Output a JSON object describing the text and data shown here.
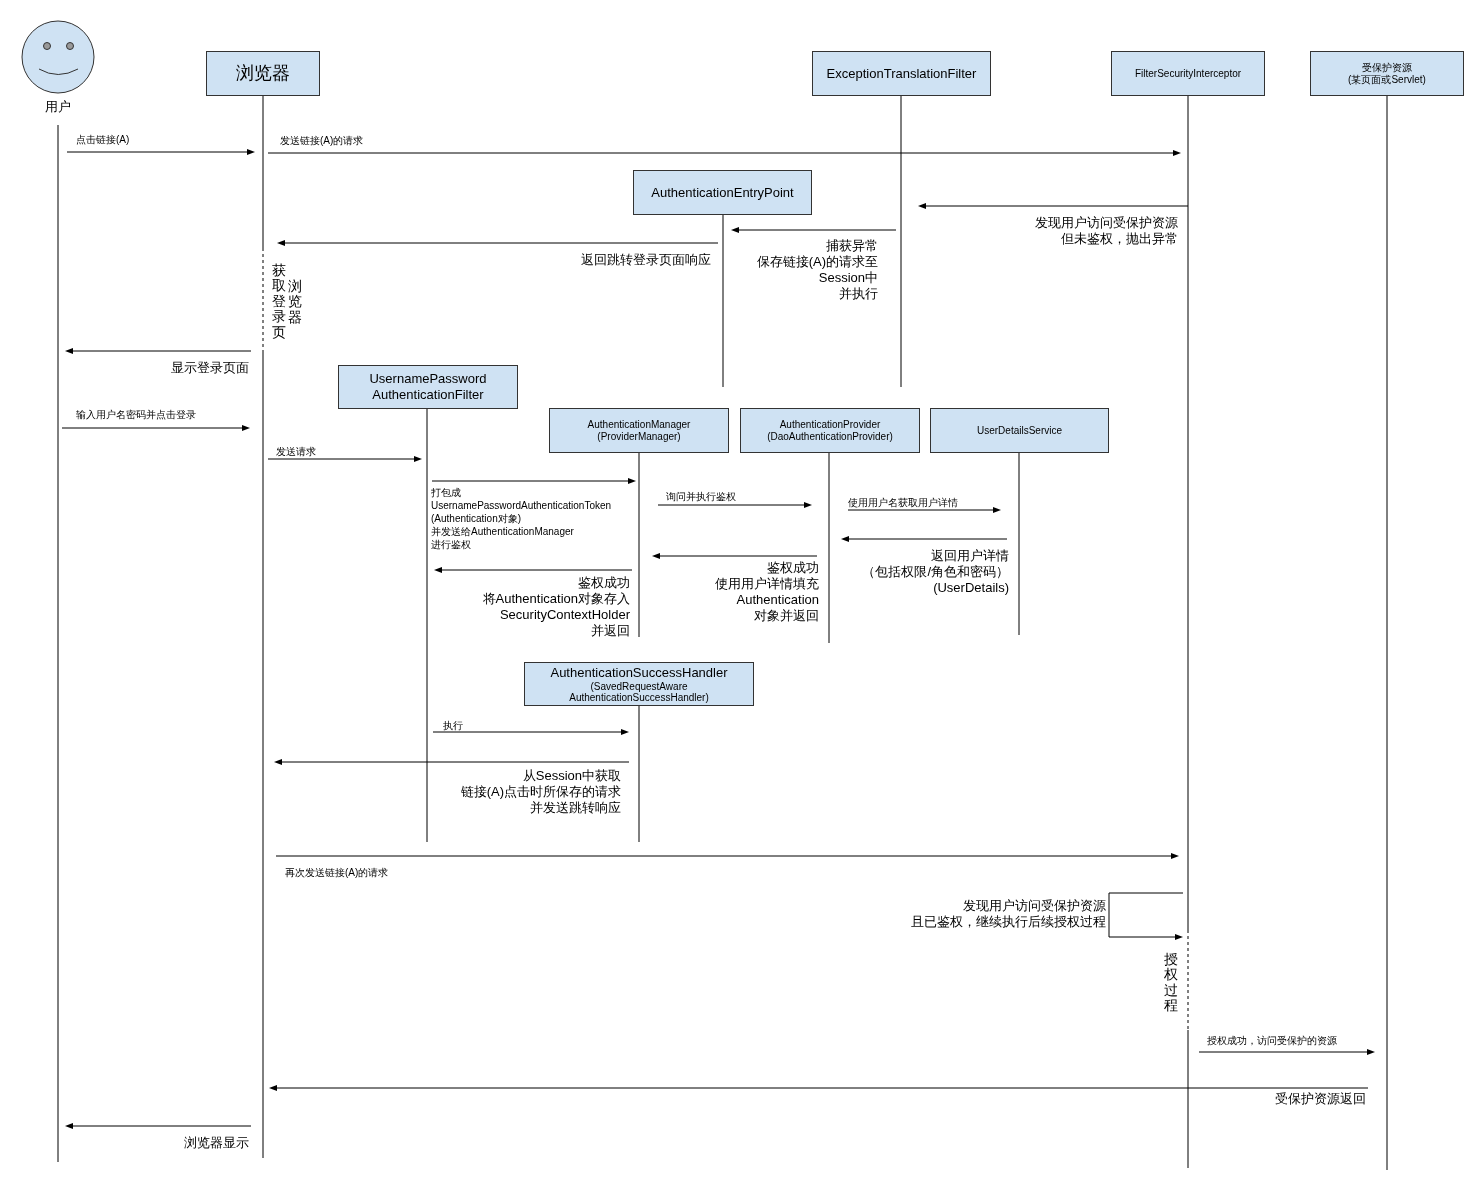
{
  "actor": {
    "label": "用户"
  },
  "participants": [
    {
      "lines": [
        "浏览器"
      ]
    },
    {
      "lines": [
        "ExceptionTranslationFilter"
      ]
    },
    {
      "lines": [
        "FilterSecurityInterceptor"
      ]
    },
    {
      "lines": [
        "受保护资源",
        "(某页面或Servlet)"
      ]
    },
    {
      "lines": [
        "AuthenticationEntryPoint"
      ]
    },
    {
      "lines": [
        "UsernamePassword",
        "AuthenticationFilter"
      ]
    },
    {
      "lines": [
        "AuthenticationManager",
        "(ProviderManager)"
      ]
    },
    {
      "lines": [
        "AuthenticationProvider",
        "(DaoAuthenticationProvider)"
      ]
    },
    {
      "lines": [
        "UserDetailsService"
      ]
    },
    {
      "lines": [
        "AuthenticationSuccessHandler"
      ],
      "subtitle_lines": [
        "(SavedRequestAware",
        "AuthenticationSuccessHandler)"
      ]
    }
  ],
  "messages": [
    {
      "kind": "arrow",
      "leftward": false,
      "lines": [
        "点击链接(A)"
      ]
    },
    {
      "kind": "arrow",
      "leftward": false,
      "lines": [
        "发送链接(A)的请求"
      ]
    },
    {
      "kind": "arrow",
      "leftward": true,
      "lines": [
        "发现用户访问受保护资源",
        "但未鉴权，抛出异常"
      ]
    },
    {
      "kind": "arrow",
      "leftward": true,
      "lines": [
        "捕获异常",
        "保存链接(A)的请求至",
        "Session中",
        "并执行"
      ]
    },
    {
      "kind": "arrow",
      "leftward": true,
      "lines": [
        "返回跳转登录页面响应"
      ]
    },
    {
      "kind": "arrow",
      "leftward": true,
      "lines": [
        "显示登录页面"
      ]
    },
    {
      "kind": "arrow",
      "leftward": false,
      "lines": [
        "输入用户名密码并点击登录"
      ]
    },
    {
      "kind": "arrow",
      "leftward": false,
      "lines": [
        "发送请求"
      ]
    },
    {
      "kind": "arrow",
      "leftward": false,
      "lines": [
        "打包成",
        "UsernamePasswordAuthenticationToken",
        "(Authentication对象)",
        "并发送给AuthenticationManager",
        "进行鉴权"
      ]
    },
    {
      "kind": "arrow",
      "leftward": false,
      "lines": [
        "询问并执行鉴权"
      ]
    },
    {
      "kind": "arrow",
      "leftward": false,
      "lines": [
        "使用用户名获取用户详情"
      ]
    },
    {
      "kind": "arrow",
      "leftward": true,
      "lines": [
        "返回用户详情",
        "（包括权限/角色和密码）",
        "(UserDetails)"
      ]
    },
    {
      "kind": "arrow",
      "leftward": true,
      "lines": [
        "鉴权成功",
        "使用用户详情填充",
        "Authentication",
        "对象并返回"
      ]
    },
    {
      "kind": "arrow",
      "leftward": true,
      "lines": [
        "鉴权成功",
        "将Authentication对象存入",
        "SecurityContextHolder",
        "并返回"
      ]
    },
    {
      "kind": "arrow",
      "leftward": false,
      "lines": [
        "执行"
      ]
    },
    {
      "kind": "arrow",
      "leftward": true,
      "lines": [
        "从Session中获取",
        "链接(A)点击时所保存的请求",
        "并发送跳转响应"
      ]
    },
    {
      "kind": "arrow",
      "leftward": false,
      "lines": [
        "再次发送链接(A)的请求"
      ]
    },
    {
      "kind": "loop",
      "leftward": false,
      "lines": [
        "发现用户访问受保护资源",
        "且已鉴权，继续执行后续授权过程"
      ]
    },
    {
      "kind": "arrow",
      "leftward": false,
      "lines": [
        "授权成功，访问受保护的资源"
      ]
    },
    {
      "kind": "arrow",
      "leftward": true,
      "lines": [
        "受保护资源返回"
      ]
    },
    {
      "kind": "arrow",
      "leftward": true,
      "lines": [
        "浏览器显示"
      ]
    }
  ],
  "notes": [
    {
      "columns": [
        "获取登录页",
        "浏览器"
      ]
    },
    {
      "columns": [
        "授权过程"
      ]
    }
  ]
}
